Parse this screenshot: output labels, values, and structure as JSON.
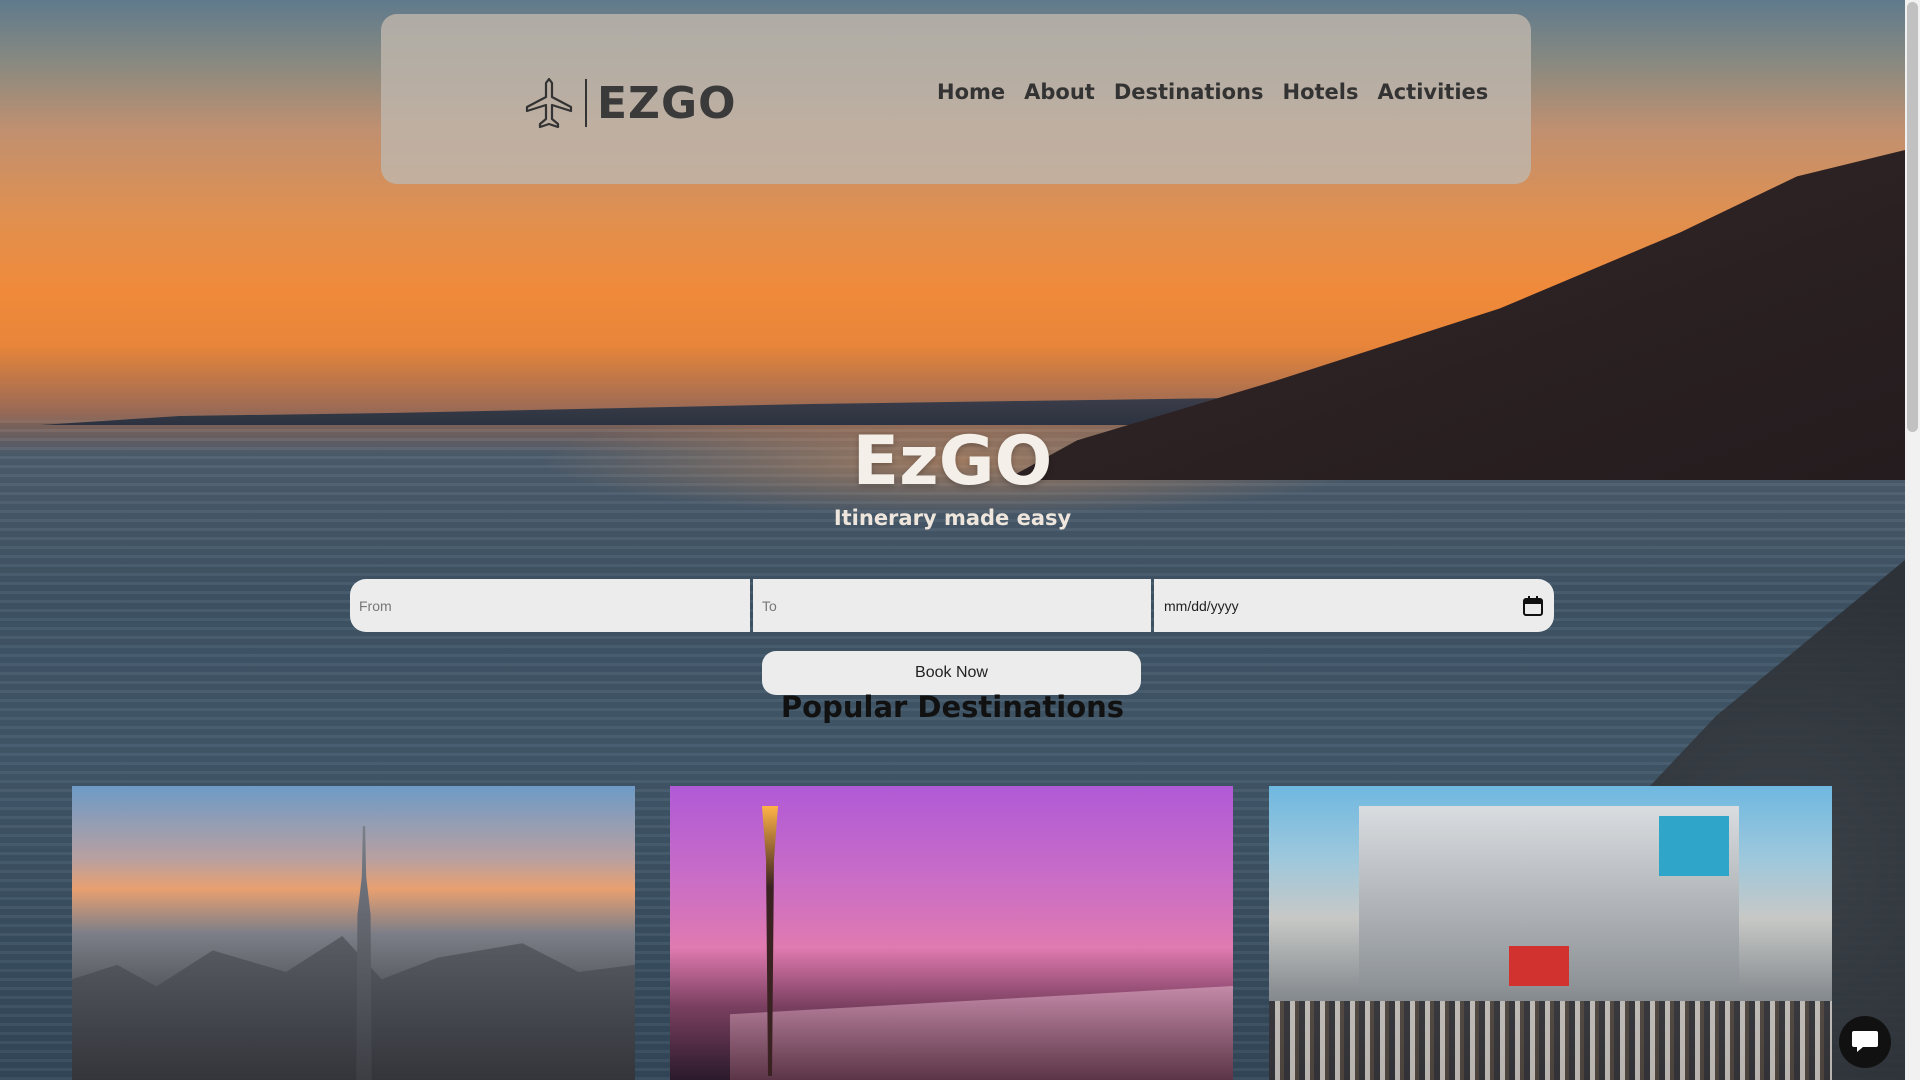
{
  "brand": {
    "logo_text": "EZGO",
    "logo_icon": "airplane-icon"
  },
  "nav": {
    "links": [
      {
        "label": "Home"
      },
      {
        "label": "About"
      },
      {
        "label": "Destinations"
      },
      {
        "label": "Hotels"
      },
      {
        "label": "Activities"
      }
    ]
  },
  "hero": {
    "title": "EzGO",
    "subtitle": "Itinerary made easy"
  },
  "booking": {
    "from_placeholder": "From",
    "to_placeholder": "To",
    "date_value": "mm/dd/yyyy",
    "date_icon": "calendar-icon",
    "book_label": "Book Now"
  },
  "popular": {
    "title": "Popular Destinations"
  },
  "chat": {
    "icon": "chat-icon"
  },
  "colors": {
    "nav_bg": "#beb6ac",
    "input_bg": "#ececec",
    "title_text": "#f4efe8"
  }
}
